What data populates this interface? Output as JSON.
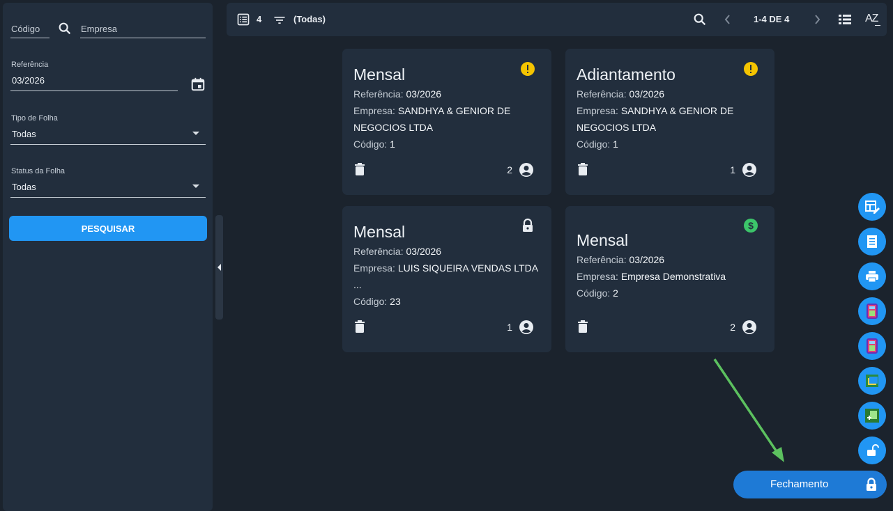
{
  "filters": {
    "codigo_placeholder": "Código",
    "empresa_placeholder": "Empresa",
    "referencia_label": "Referência",
    "referencia_value": "03/2026",
    "tipo_label": "Tipo de Folha",
    "tipo_value": "Todas",
    "status_label": "Status da Folha",
    "status_value": "Todas",
    "search_button": "PESQUISAR"
  },
  "toolbar": {
    "count": "4",
    "filter_text": "(Todas)",
    "pagination": "1-4 DE 4",
    "sort_label": "AZ"
  },
  "cards": [
    {
      "title": "Mensal",
      "ref_label": "Referência:",
      "ref": "03/2026",
      "empresa_label": "Empresa:",
      "empresa": "SANDHYA & GENIOR DE NEGOCIOS LTDA",
      "codigo_label": "Código:",
      "codigo": "1",
      "people": "2",
      "status_icon": "warning-icon"
    },
    {
      "title": "Adiantamento",
      "ref_label": "Referência:",
      "ref": "03/2026",
      "empresa_label": "Empresa:",
      "empresa": "SANDHYA & GENIOR DE NEGOCIOS LTDA",
      "codigo_label": "Código:",
      "codigo": "1",
      "people": "1",
      "status_icon": "warning-icon"
    },
    {
      "title": "Mensal",
      "ref_label": "Referência:",
      "ref": "03/2026",
      "empresa_label": "Empresa:",
      "empresa": "LUIS SIQUEIRA VENDAS LTDA ...",
      "codigo_label": "Código:",
      "codigo": "23",
      "people": "1",
      "status_icon": "lock-icon"
    },
    {
      "title": "Mensal",
      "ref_label": "Referência:",
      "ref": "03/2026",
      "empresa_label": "Empresa:",
      "empresa": "Empresa Demonstrativa",
      "codigo_label": "Código:",
      "codigo": "2",
      "people": "2",
      "status_icon": "dollar-icon"
    }
  ],
  "fechamento_button": "Fechamento",
  "colors": {
    "accent": "#2196f3",
    "warning": "#f5c400",
    "money": "#3cc46a",
    "arrow": "#5cc15f"
  }
}
